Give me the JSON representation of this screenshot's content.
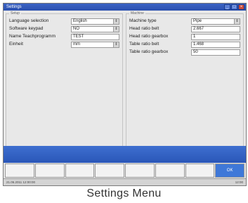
{
  "window": {
    "title": "Settings"
  },
  "left": {
    "legend": "Setup",
    "rows": [
      {
        "label": "Language selection",
        "value": "English",
        "type": "dropdown"
      },
      {
        "label": "Software keypad",
        "value": "NO",
        "type": "dropdown"
      },
      {
        "label": "Name Teachprogramm",
        "value": "TEST",
        "type": "text"
      },
      {
        "label": "Einheit",
        "value": "mm",
        "type": "dropdown"
      }
    ]
  },
  "right": {
    "legend": "Machine",
    "rows": [
      {
        "label": "Machine type",
        "value": "Pipe",
        "type": "dropdown"
      },
      {
        "label": "Head ratio belt",
        "value": "2.667",
        "type": "text"
      },
      {
        "label": "Head ratio gearbox",
        "value": "1",
        "type": "text"
      },
      {
        "label": "Table ratio belt",
        "value": "1.468",
        "type": "text"
      },
      {
        "label": "Table ratio gearbox",
        "value": "50",
        "type": "text"
      }
    ]
  },
  "softkeys": [
    "",
    "",
    "",
    "",
    "",
    "",
    "",
    "OK"
  ],
  "status": {
    "left": "21.06.2011 12:00:00",
    "middle": "",
    "right": "12:00"
  },
  "caption": "Settings Menu",
  "icons": {
    "dropdown": "chevron-down-icon",
    "minimize": "minimize-icon",
    "maximize": "maximize-icon",
    "close": "close-icon"
  },
  "colors": {
    "accent": "#2a57b8",
    "ok": "#3f78d8"
  }
}
